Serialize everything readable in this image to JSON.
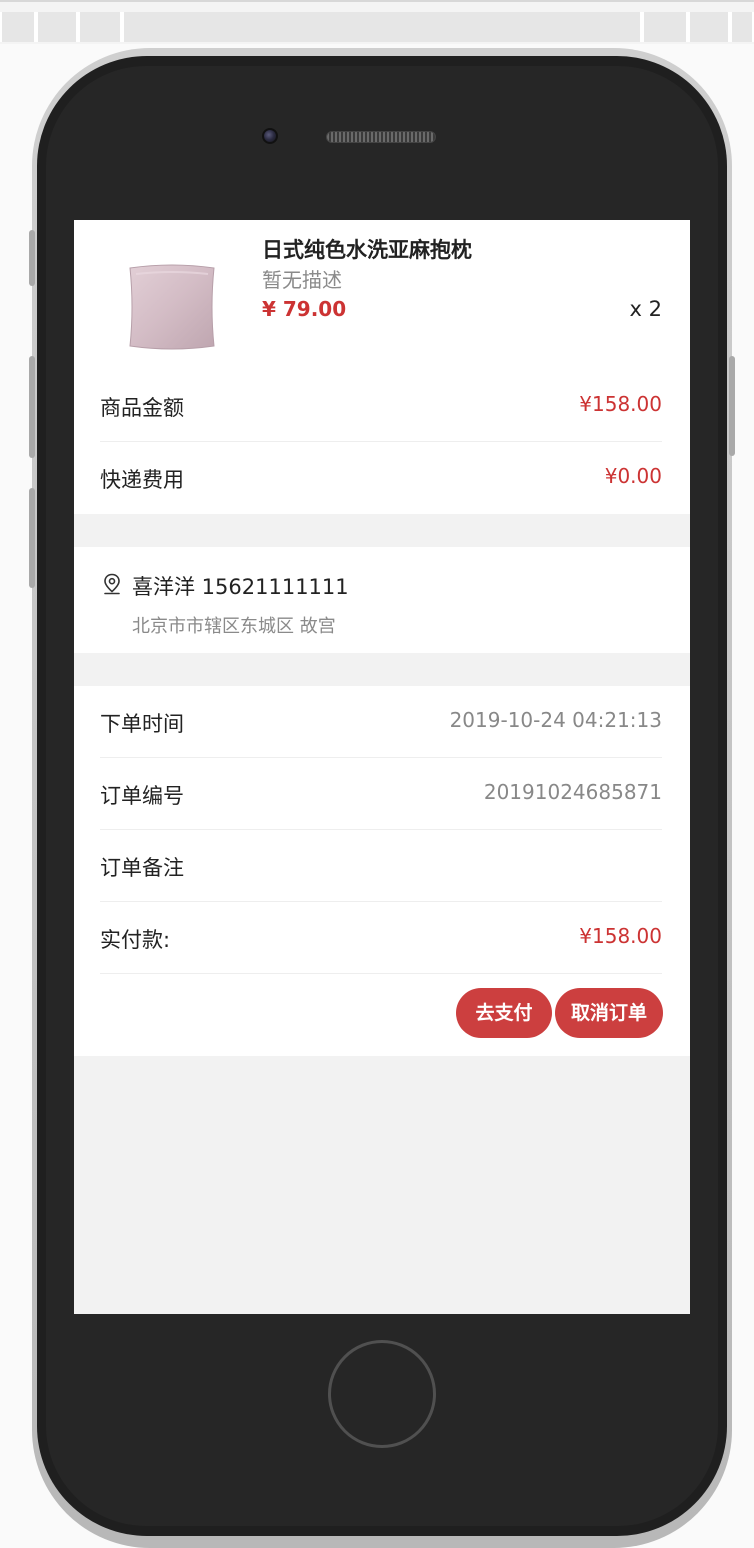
{
  "product": {
    "name": "日式纯色水洗亚麻抱枕",
    "description": "暂无描述",
    "price": "¥ 79.00",
    "quantity": "x 2"
  },
  "summary": {
    "goods_amount_label": "商品金额",
    "goods_amount_value": "¥158.00",
    "shipping_label": "快递费用",
    "shipping_value": "¥0.00"
  },
  "address": {
    "name_phone": "喜洋洋 15621111111",
    "detail": "北京市市辖区东城区 故宫"
  },
  "order": {
    "time_label": "下单时间",
    "time_value": "2019-10-24 04:21:13",
    "number_label": "订单编号",
    "number_value": "20191024685871",
    "remark_label": "订单备注",
    "remark_value": "",
    "paid_label": "实付款:",
    "paid_value": "¥158.00"
  },
  "actions": {
    "pay_label": "去支付",
    "cancel_label": "取消订单"
  },
  "colors": {
    "accent": "#cc3f3f",
    "price_red": "#cc3333",
    "background": "#f2f2f2"
  }
}
